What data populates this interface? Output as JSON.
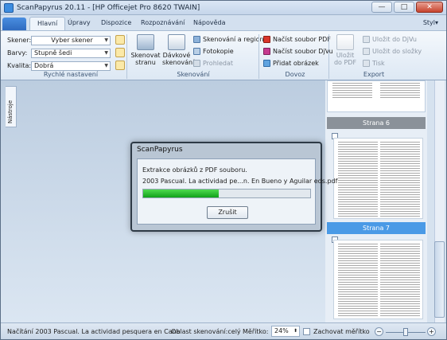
{
  "window": {
    "title": "ScanPapyrus 20.11 - [HP Officejet Pro 8620 TWAIN]",
    "minimize": "—",
    "maximize": "□",
    "close": "✕"
  },
  "tabs": [
    "Hlavní",
    "Úpravy",
    "Dispozice",
    "Rozpoznávání",
    "Nápověda"
  ],
  "style_label": "Styl",
  "quick_settings": {
    "scanner_label": "Skener:",
    "scanner_value": "Vyber skener",
    "color_label": "Barvy:",
    "color_value": "Stupně šedi",
    "quality_label": "Kvalita:",
    "quality_value": "Dobrá",
    "group": "Rychlé nastavení"
  },
  "scan_group": {
    "scan_page": "Skenovat stranu",
    "batch_scan": "Dávkové skenování",
    "scan_region": "Skenování a region",
    "photocopy": "Fotokopie",
    "browse": "Prohledat",
    "group": "Skenování"
  },
  "import_group": {
    "load_pdf": "Načíst soubor PDF",
    "load_djvu": "Načíst soubor DjVu",
    "add_image": "Přidat obrázek",
    "group": "Dovoz"
  },
  "export_group": {
    "save_pdf": "Uložit do PDF",
    "save_djvu": "Uložit do DjVu",
    "save_folder": "Uložit do složky",
    "print": "Tisk",
    "group": "Export"
  },
  "tools_tab": "Nástroje",
  "pages": [
    {
      "label": "Strana 6"
    },
    {
      "label": "Strana 7"
    }
  ],
  "dialog": {
    "title": "ScanPapyrus",
    "line1": "Extrakce obrázků z PDF souboru.",
    "line2": "2003 Pascual. La actividad pe...n. En Bueno y Aguilar eds.pdf",
    "progress": 0.45,
    "cancel": "Zrušit"
  },
  "status": {
    "loading": "Načítání 2003 Pascual. La actividad pesquera en Cana",
    "scan_area": "Oblast skenování:celý",
    "scale_label": "Měřítko:",
    "scale_value": "24%",
    "keep_scale": "Zachovat měřítko"
  },
  "colors": {
    "accent": "#3d8de0",
    "page_header": "#8a9199",
    "page_header_active": "#4a9ae6",
    "progress_green": "#23b82a"
  }
}
